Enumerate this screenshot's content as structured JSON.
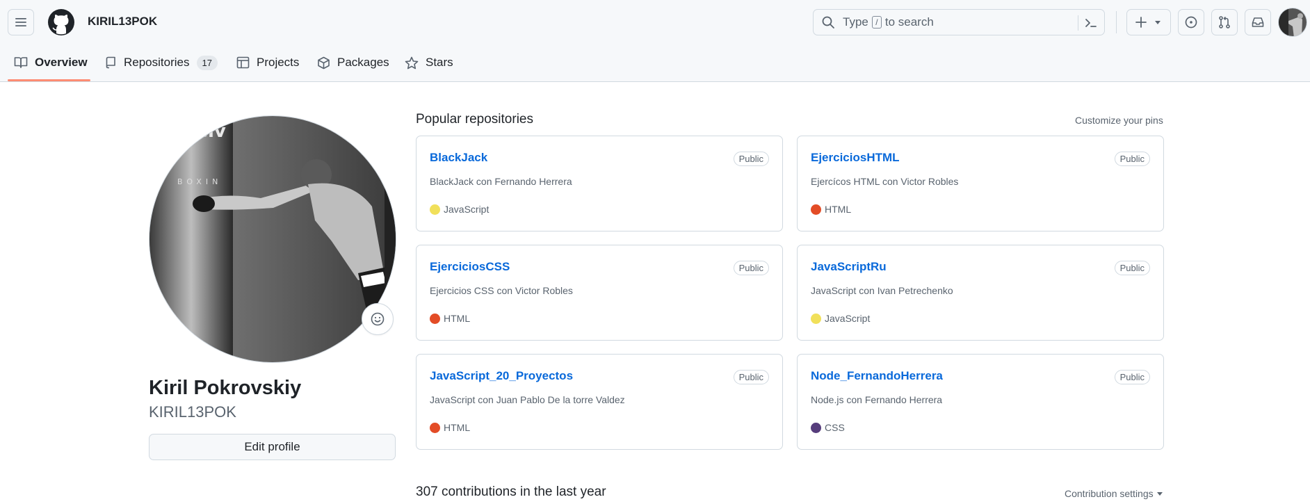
{
  "header": {
    "username": "KIRIL13POK",
    "search": {
      "before_key": "Type",
      "key": "/",
      "after_key": "to search"
    }
  },
  "tabs": [
    {
      "label": "Overview",
      "icon": "book-icon"
    },
    {
      "label": "Repositories",
      "count": "17",
      "icon": "repo-icon"
    },
    {
      "label": "Projects",
      "icon": "table-icon"
    },
    {
      "label": "Packages",
      "icon": "package-icon"
    },
    {
      "label": "Stars",
      "icon": "star-icon"
    }
  ],
  "profile": {
    "full_name": "Kiril Pokrovskiy",
    "login": "KIRIL13POK",
    "edit_button": "Edit profile"
  },
  "popular": {
    "title": "Popular repositories",
    "customize": "Customize your pins",
    "repos": [
      {
        "name": "BlackJack",
        "visibility": "Public",
        "description": "BlackJack con Fernando Herrera",
        "language": "JavaScript",
        "color": "#f1e05a"
      },
      {
        "name": "EjerciciosHTML",
        "visibility": "Public",
        "description": "Ejercícos HTML con Victor Robles",
        "language": "HTML",
        "color": "#e34c26"
      },
      {
        "name": "EjerciciosCSS",
        "visibility": "Public",
        "description": "Ejercicios CSS con Victor Robles",
        "language": "HTML",
        "color": "#e34c26"
      },
      {
        "name": "JavaScriptRu",
        "visibility": "Public",
        "description": "JavaScript con Ivan Petrechenko",
        "language": "JavaScript",
        "color": "#f1e05a"
      },
      {
        "name": "JavaScript_20_Proyectos",
        "visibility": "Public",
        "description": "JavaScript con Juan Pablo De la torre Valdez",
        "language": "HTML",
        "color": "#e34c26"
      },
      {
        "name": "Node_FernandoHerrera",
        "visibility": "Public",
        "description": "Node.js con Fernando Herrera",
        "language": "CSS",
        "color": "#563d7c"
      }
    ]
  },
  "contributions": {
    "title": "307 contributions in the last year",
    "settings": "Contribution settings"
  },
  "colors": {
    "link": "#0969da",
    "tab_underline": "#fd8c73",
    "border": "#d1d9e0",
    "muted_text": "#59636e"
  }
}
